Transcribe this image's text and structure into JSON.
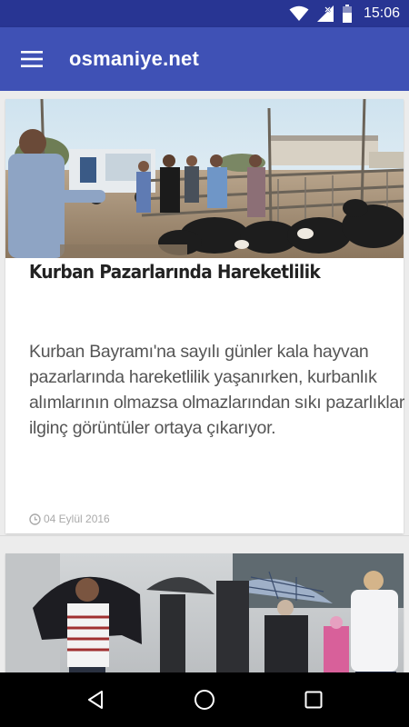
{
  "status_bar": {
    "time": "15:06",
    "icons": [
      "wifi-icon",
      "signal-no-data-icon",
      "battery-icon"
    ]
  },
  "app_bar": {
    "menu_icon": "hamburger-menu-icon",
    "title": "osmaniye.net",
    "color": "#3f51b5",
    "status_color": "#283593"
  },
  "articles": [
    {
      "image": "livestock-market-photo",
      "title": "Kurban Pazarlarında Hareketlilik",
      "summary": "Kurban Bayramı'na sayılı günler kala hayvan pazarlarında hareketlilik yaşanırken, kurbanlık alımlarının olmazsa olmazlarından sıkı pazarlıklar ilginç görüntüler ortaya çıkarıyor.",
      "date_icon": "clock-icon",
      "date": "04 Eylül 2016"
    },
    {
      "image": "rainy-street-umbrellas-photo"
    }
  ],
  "nav_bar": {
    "buttons": [
      "back-icon",
      "home-icon",
      "recents-icon"
    ]
  }
}
